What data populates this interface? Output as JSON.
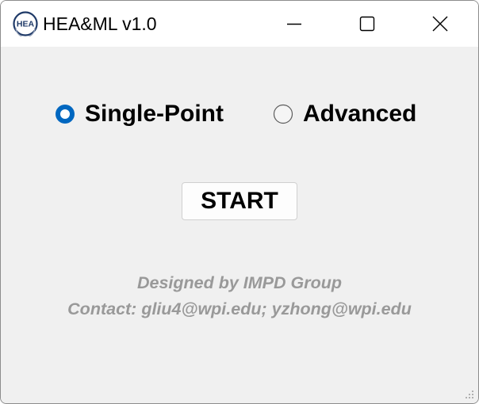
{
  "window": {
    "title": "HEA&ML v1.0",
    "logo_text": "HEA",
    "logo_icon": "hea-logo-icon",
    "controls": {
      "minimize_icon": "minimize-icon",
      "maximize_icon": "maximize-icon",
      "close_icon": "close-icon"
    }
  },
  "mode": {
    "options": [
      {
        "label": "Single-Point",
        "selected": true
      },
      {
        "label": "Advanced",
        "selected": false
      }
    ]
  },
  "actions": {
    "start_label": "START"
  },
  "footer": {
    "designed_by": "Designed by IMPD Group",
    "contact": "Contact: gliu4@wpi.edu; yzhong@wpi.edu"
  },
  "colors": {
    "accent": "#0067c0",
    "footer_text": "#999999",
    "client_bg": "#f0f0f0",
    "titlebar_bg": "#ffffff"
  }
}
